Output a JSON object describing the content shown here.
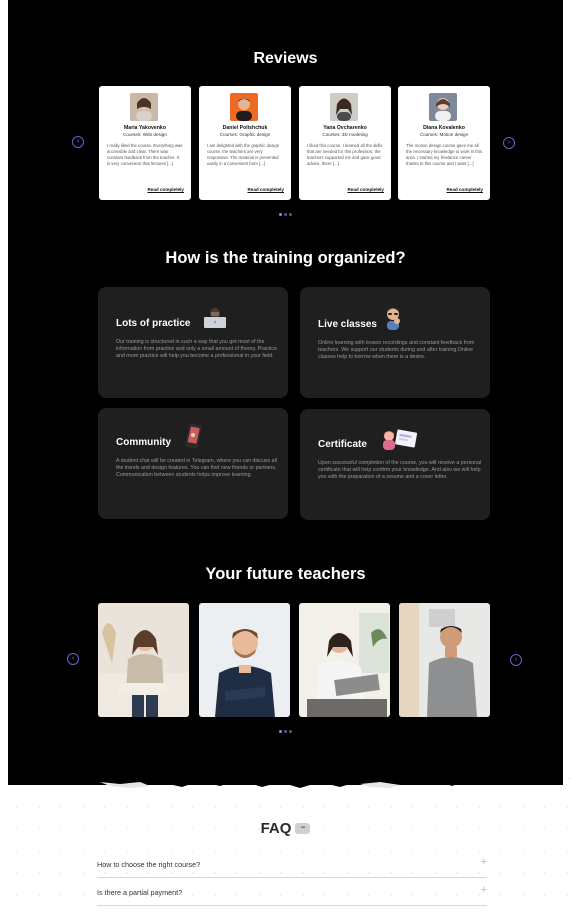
{
  "reviews": {
    "title": "Reviews",
    "prev_icon": "chevron-left-icon",
    "next_icon": "chevron-right-icon",
    "items": [
      {
        "name": "Maria Yakovenko",
        "course": "Courses: Web design",
        "text": "I really liked the course. Everything was accessible and clear. There was constant feedback from the teacher. It is very convenient that lectures [...]",
        "link": "Read completely"
      },
      {
        "name": "Daniel Polishchuk",
        "course": "Courses: Graphic design",
        "text": "I am delighted with the graphic design course, the teachers are very responsive. The material is presented easily in a convenient form [...]",
        "link": "Read completely"
      },
      {
        "name": "Yana Ovcharenko",
        "course": "Courses: 3D modeling",
        "text": "I liked this course. I learned all the skills that are needed for this profession, the teachers supported me and gave good advice, there [...]",
        "link": "Read completely"
      },
      {
        "name": "Diana Kovalenko",
        "course": "Courses: Motion design",
        "text": "The motion design course gave me all the necessary knowledge to work in this area. I started my freelance career thanks to this course and I want [...]",
        "link": "Read completely"
      }
    ]
  },
  "training": {
    "title": "How is the training organized?",
    "cards": [
      {
        "title": "Lots of practice",
        "icon": "laptop-person-icon",
        "desc": "Our training is structured in such a way that you get most of the information from practice and only a small amount of theory. Practice and more practice will help you become a professional in your field."
      },
      {
        "title": "Live classes",
        "icon": "thinking-person-icon",
        "desc": "Online learning with lesson recordings and constant feedback from teachers. We support our students during and after training.Online classes help to borrow when there is a desire."
      },
      {
        "title": "Community",
        "icon": "phone-chat-icon",
        "desc": "A student chat will be created in Telegram, where you can discuss all the trends and design features. You can find new friends or partners. Communication between students helps improve learning."
      },
      {
        "title": "Certificate",
        "icon": "certificate-icon",
        "desc": "Upon successful completion of the course, you will receive a personal certificate that will help confirm your knowledge. And also we will help you with the preparation of a resume and a cover letter."
      }
    ]
  },
  "teachers": {
    "title": "Your future teachers"
  },
  "faq": {
    "title": "FAQ",
    "icon": "chat-bubble-icon",
    "items": [
      {
        "question": "How to choose the right course?",
        "icon": "plus-icon"
      },
      {
        "question": "Is there a partial payment?",
        "icon": "plus-icon"
      }
    ]
  },
  "colors": {
    "background_dark": "#000000",
    "card_dark": "#1f1f1f",
    "accent": "#7d8ce8"
  }
}
